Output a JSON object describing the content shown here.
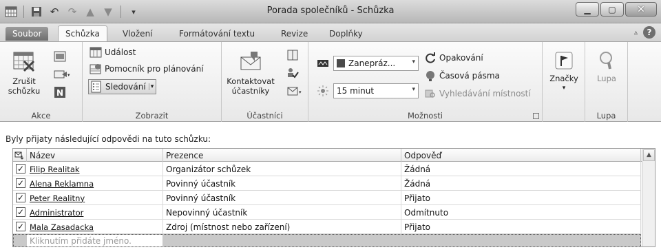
{
  "window": {
    "title": "Porada společníků - Schůzka"
  },
  "tabs": [
    {
      "label": "Soubor"
    },
    {
      "label": "Schůzka"
    },
    {
      "label": "Vložení"
    },
    {
      "label": "Formátování textu"
    },
    {
      "label": "Revize"
    },
    {
      "label": "Doplňky"
    }
  ],
  "ribbon": {
    "akce": {
      "group_label": "Akce",
      "cancel_label": "Zrušit\nschůzku"
    },
    "zobrazit": {
      "group_label": "Zobrazit",
      "udalost": "Událost",
      "pomocnik": "Pomocník pro plánování",
      "sledovani": "Sledování"
    },
    "ucastnici": {
      "group_label": "Účastníci",
      "kontaktovat": "Kontaktovat\núčastníky"
    },
    "moznosti": {
      "group_label": "Možnosti",
      "show_as": "Zanepráz...",
      "reminder": "15 minut",
      "opakovani": "Opakování",
      "casova_pasma": "Časová pásma",
      "vyhledavani": "Vyhledávání místností"
    },
    "znacky": {
      "label": "Značky"
    },
    "lupa": {
      "label": "Lupa",
      "group_label": "Lupa"
    }
  },
  "content": {
    "info_text": "Byly přijaty následující odpovědi na tuto schůzku:",
    "columns": [
      "Název",
      "Prezence",
      "Odpověď"
    ],
    "rows": [
      {
        "name": "Filip Realitak",
        "presence": "Organizátor schůzek",
        "response": "Žádná"
      },
      {
        "name": "Alena Reklamna",
        "presence": "Povinný účastník",
        "response": "Žádná"
      },
      {
        "name": "Peter Realitny",
        "presence": "Povinný účastník",
        "response": "Přijato"
      },
      {
        "name": "Administrator",
        "presence": "Nepovinný účastník",
        "response": "Odmítnuto"
      },
      {
        "name": "Mala Zasadacka",
        "presence": "Zdroj (místnost nebo zařízení)",
        "response": "Přijato"
      }
    ],
    "new_row_placeholder": "Kliknutím přidáte jméno."
  }
}
